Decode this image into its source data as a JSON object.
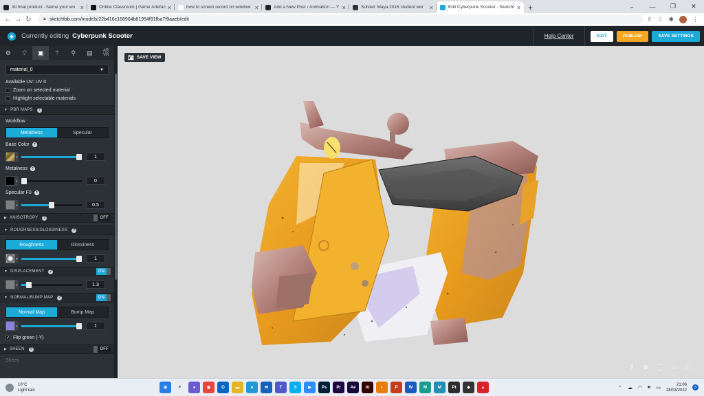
{
  "browser": {
    "tabs": [
      {
        "title": "3d final product - Name your wo",
        "fav": "#222222",
        "active": false
      },
      {
        "title": "Online Classroom | Game Artefac",
        "fav": "#111111",
        "active": false
      },
      {
        "title": "how to screen record on window",
        "fav": "#ffffff",
        "active": false
      },
      {
        "title": "Add a New Post ‹ Animation — Y",
        "fav": "#222222",
        "active": false
      },
      {
        "title": "Solved: Maya 2016 student wor",
        "fav": "#333333",
        "active": false
      },
      {
        "title": "Edit Cyberpunk Scooter - Sketchf",
        "fav": "#1caad9",
        "active": true
      }
    ],
    "new_tab": "+",
    "url": "sketchfab.com/models/22b416c168904b81954f91fba7f9aaeb/edit"
  },
  "header": {
    "currently_editing": "Currently editing",
    "model_name": "Cyberpunk Scooter",
    "help": "Help Center",
    "exit": "EXIT",
    "publish": "PUBLISH",
    "save": "SAVE SETTINGS"
  },
  "sidebar": {
    "tab_icons": [
      "gear-icon",
      "bulb-icon",
      "image-icon",
      "wand-icon",
      "pin-icon",
      "film-icon"
    ],
    "arvr": "AR\nVR",
    "material": "material_0",
    "available_uv": "Available UV: UV 0",
    "zoom": "Zoom on selected material",
    "highlight": "Highlight selectable materials",
    "pbr": "PBR MAPS",
    "workflow": "Workflow",
    "metalness_tab": "Metalness",
    "specular_tab": "Specular",
    "base_color": "Base Color",
    "base_color_val": "1",
    "metalness": "Metalness",
    "metalness_val": "0",
    "specular_f0": "Specular F0",
    "specular_f0_val": "0.5",
    "anisotropy": "ANISOTROPY",
    "anisotropy_state": "OFF",
    "rough_gloss": "ROUGHNESS/GLOSSINESS",
    "roughness_tab": "Roughness",
    "glossiness_tab": "Glossiness",
    "roughness_val": "1",
    "displacement": "DISPLACEMENT",
    "displacement_state": "ON",
    "displacement_val": "1.3",
    "normal_bump": "NORMAL/BUMP MAP",
    "normal_state": "ON",
    "normal_tab": "Normal Map",
    "bump_tab": "Bump Map",
    "normal_val": "1",
    "flip_green": "Flip green (-Y)",
    "sheen": "SHEEN",
    "sheen_state": "OFF",
    "sheen_label": "Sheen"
  },
  "slider_levels": {
    "base_color": 1.0,
    "metalness": 0.0,
    "specular_f0": 0.5,
    "roughness": 1.0,
    "displacement": 0.13,
    "normal": 1.0
  },
  "viewport": {
    "save_view": "SAVE VIEW"
  },
  "taskbar": {
    "temp": "10°C",
    "weather": "Light rain",
    "time": "21:06",
    "date": "28/03/2022",
    "apps": [
      {
        "icon": "windows-icon",
        "c": "#2a7de1",
        "t": "⊞"
      },
      {
        "icon": "search-icon",
        "c": "#e9eef4",
        "t": "⌕"
      },
      {
        "icon": "chat-icon",
        "c": "#6b5bd2",
        "t": "●"
      },
      {
        "icon": "chrome-icon",
        "c": "#e8453c",
        "t": "◉"
      },
      {
        "icon": "outlook-icon",
        "c": "#0a64c4",
        "t": "O"
      },
      {
        "icon": "folder-icon",
        "c": "#e8b324",
        "t": "▬"
      },
      {
        "icon": "edge-icon",
        "c": "#1f9ad6",
        "t": "e"
      },
      {
        "icon": "mail-icon",
        "c": "#1560bd",
        "t": "✉"
      },
      {
        "icon": "teams-icon",
        "c": "#5059c9",
        "t": "T"
      },
      {
        "icon": "skype-icon",
        "c": "#00aff0",
        "t": "S"
      },
      {
        "icon": "zoom-icon",
        "c": "#2d8cff",
        "t": "▶"
      },
      {
        "icon": "photoshop-icon",
        "c": "#001e36",
        "t": "Ps"
      },
      {
        "icon": "premiere-icon",
        "c": "#1f0040",
        "t": "Pr"
      },
      {
        "icon": "aftereffects-icon",
        "c": "#1a0a3a",
        "t": "Ae"
      },
      {
        "icon": "illustrator-icon",
        "c": "#330000",
        "t": "Ai"
      },
      {
        "icon": "blender-icon",
        "c": "#e87d0d",
        "t": "◐"
      },
      {
        "icon": "powerpoint-icon",
        "c": "#c43e1c",
        "t": "P"
      },
      {
        "icon": "word-icon",
        "c": "#185abd",
        "t": "W"
      },
      {
        "icon": "mudbox-icon",
        "c": "#1a9c8e",
        "t": "M"
      },
      {
        "icon": "maya-icon",
        "c": "#1e8fb5",
        "t": "M"
      },
      {
        "icon": "substance-icon",
        "c": "#2d2d2d",
        "t": "Pt"
      },
      {
        "icon": "unity-icon",
        "c": "#333333",
        "t": "◈"
      },
      {
        "icon": "paint-icon",
        "c": "#d8232a",
        "t": "▲"
      }
    ]
  }
}
